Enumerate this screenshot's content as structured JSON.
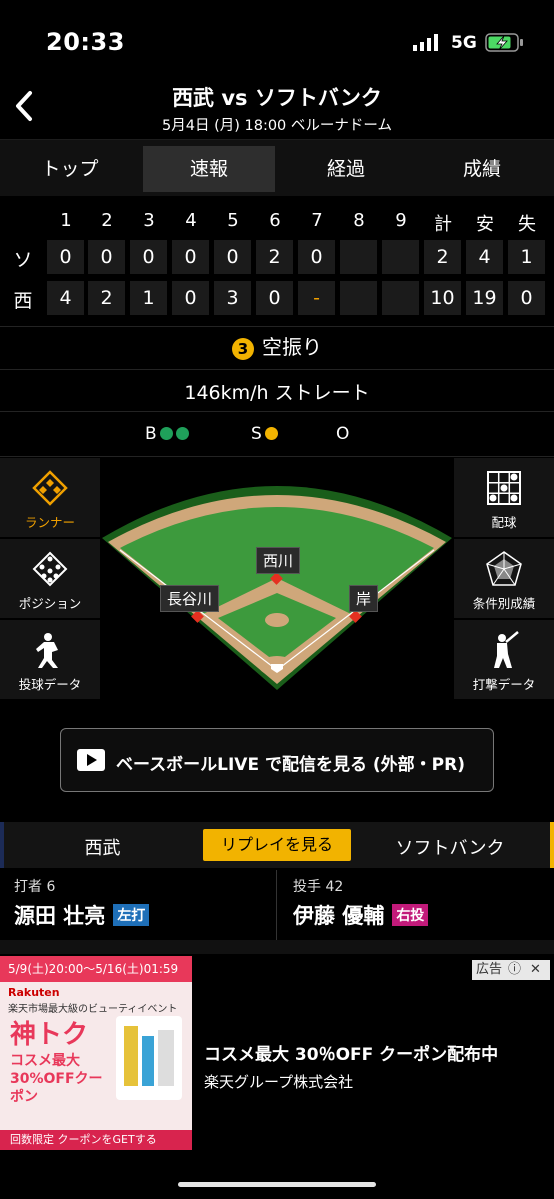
{
  "status": {
    "time": "20:33",
    "network": "5G"
  },
  "header": {
    "title": "西武 vs ソフトバンク",
    "subtitle": "5月4日 (月) 18:00 ベルーナドーム"
  },
  "tabs": [
    "トップ",
    "速報",
    "経過",
    "成績"
  ],
  "active_tab": 1,
  "scoreboard": {
    "headers": [
      "1",
      "2",
      "3",
      "4",
      "5",
      "6",
      "7",
      "8",
      "9",
      "計",
      "安",
      "失"
    ],
    "rows": [
      {
        "team": "ソ",
        "innings": [
          "0",
          "0",
          "0",
          "0",
          "0",
          "2",
          "0",
          "",
          ""
        ],
        "totals": [
          "2",
          "4",
          "1"
        ]
      },
      {
        "team": "西",
        "innings": [
          "4",
          "2",
          "1",
          "0",
          "3",
          "0",
          "-",
          "",
          ""
        ],
        "totals": [
          "10",
          "19",
          "0"
        ]
      }
    ]
  },
  "play": {
    "number": "3",
    "result": "空振り"
  },
  "pitch": "146km/h ストレート",
  "count": {
    "balls_label": "B",
    "balls": 2,
    "strikes_label": "S",
    "strikes": 1,
    "outs_label": "O",
    "outs": 0
  },
  "left_panel": [
    "ランナー",
    "ポジション",
    "投球データ"
  ],
  "right_panel": [
    "配球",
    "条件別成績",
    "打撃データ"
  ],
  "fielders": {
    "second": "西川",
    "third": "長谷川",
    "first": "岸"
  },
  "broadcast": "ベースボールLIVE で配信を見る (外部・PR)",
  "teams": {
    "home": "西武",
    "replay": "リプレイを見る",
    "away": "ソフトバンク"
  },
  "batter": {
    "role": "打者 6",
    "name": "源田 壮亮",
    "hand": "左打"
  },
  "pitcher": {
    "role": "投手 42",
    "name": "伊藤 優輔",
    "hand": "右投"
  },
  "ad": {
    "banner_top": "5/9(土)20:00～5/16(土)01:59",
    "brand": "Rakuten",
    "banner_sub": "楽天市場最大級のビューティイベント",
    "banner_big": "神トク",
    "banner_offer": "コスメ最大30%OFFクーポン",
    "banner_foot": "回数限定 クーポンをGETする",
    "title": "コスメ最大 30％OFF クーポン配布中",
    "sponsor": "楽天グループ株式会社",
    "badge": "広告"
  },
  "colors": {
    "accent": "#f2b300",
    "ball": "#1fa05a",
    "strike": "#f2b300",
    "left_hand": "#1e6fb8",
    "right_hand": "#c21a7a"
  }
}
